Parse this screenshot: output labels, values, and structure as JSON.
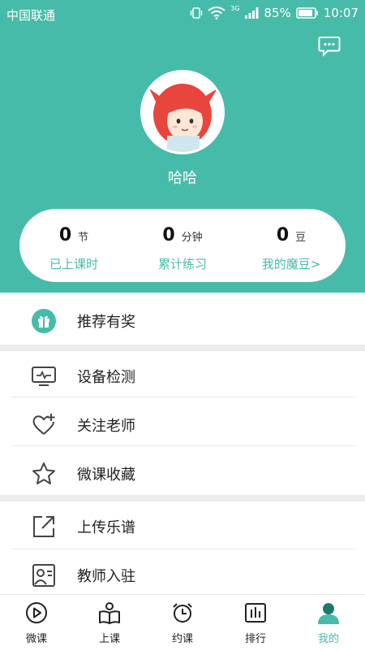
{
  "status_bar": {
    "carrier": "中国联通",
    "network": "3G",
    "battery": "85%",
    "time": "10:07"
  },
  "profile": {
    "username": "哈哈"
  },
  "stats": [
    {
      "value": "0",
      "unit": "节",
      "label": "已上课时"
    },
    {
      "value": "0",
      "unit": "分钟",
      "label": "累计练习"
    },
    {
      "value": "0",
      "unit": "豆",
      "label": "我的魔豆>"
    }
  ],
  "menu": [
    {
      "label": "推荐有奖",
      "icon": "gift-icon"
    },
    {
      "label": "设备检测",
      "icon": "monitor-icon"
    },
    {
      "label": "关注老师",
      "icon": "heart-plus-icon"
    },
    {
      "label": "微课收藏",
      "icon": "star-icon"
    },
    {
      "label": "上传乐谱",
      "icon": "external-link-icon"
    },
    {
      "label": "教师入驻",
      "icon": "teacher-id-icon"
    }
  ],
  "tabs": [
    {
      "label": "微课",
      "icon": "play-icon"
    },
    {
      "label": "上课",
      "icon": "book-reader-icon"
    },
    {
      "label": "约课",
      "icon": "alarm-clock-icon"
    },
    {
      "label": "排行",
      "icon": "bar-chart-icon"
    },
    {
      "label": "我的",
      "icon": "user-icon",
      "active": true
    }
  ],
  "colors": {
    "accent": "#47bba9",
    "text": "#222222",
    "separator": "#ececec"
  }
}
